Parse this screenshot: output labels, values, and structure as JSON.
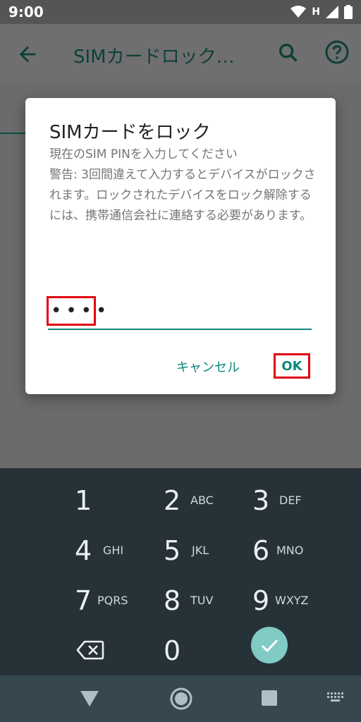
{
  "status_bar": {
    "time": "9:00",
    "network_label": "H"
  },
  "app_bar": {
    "title": "SIMカードロック…"
  },
  "dialog": {
    "title": "SIMカードをロック",
    "message": "現在のSIM PINを入力してください\n警告: 3回間違えて入力するとデバイスがロックされます。ロックされたデバイスをロック解除するには、携帯通信会社に連絡する必要があります。",
    "pin_value": "••••",
    "cancel_label": "キャンセル",
    "ok_label": "OK"
  },
  "keypad": {
    "keys": [
      {
        "digit": "1",
        "letters": ""
      },
      {
        "digit": "2",
        "letters": "ABC"
      },
      {
        "digit": "3",
        "letters": "DEF"
      },
      {
        "digit": "4",
        "letters": "GHI"
      },
      {
        "digit": "5",
        "letters": "JKL"
      },
      {
        "digit": "6",
        "letters": "MNO"
      },
      {
        "digit": "7",
        "letters": "PQRS"
      },
      {
        "digit": "8",
        "letters": "TUV"
      },
      {
        "digit": "9",
        "letters": "WXYZ"
      },
      {
        "digit": "0",
        "letters": ""
      }
    ]
  },
  "colors": {
    "accent": "#0b8a7a",
    "highlight": "#e00012",
    "keypad_bg": "#263238",
    "enter_key": "#80cbc4"
  },
  "icons": {
    "status": [
      "wifi-icon",
      "signal-icon",
      "battery-icon"
    ],
    "app_bar": [
      "back-arrow-icon",
      "search-icon",
      "help-icon"
    ],
    "keypad": [
      "backspace-icon",
      "check-icon"
    ],
    "nav": [
      "nav-back-icon",
      "nav-home-icon",
      "nav-recents-icon",
      "keyboard-switch-icon"
    ]
  }
}
